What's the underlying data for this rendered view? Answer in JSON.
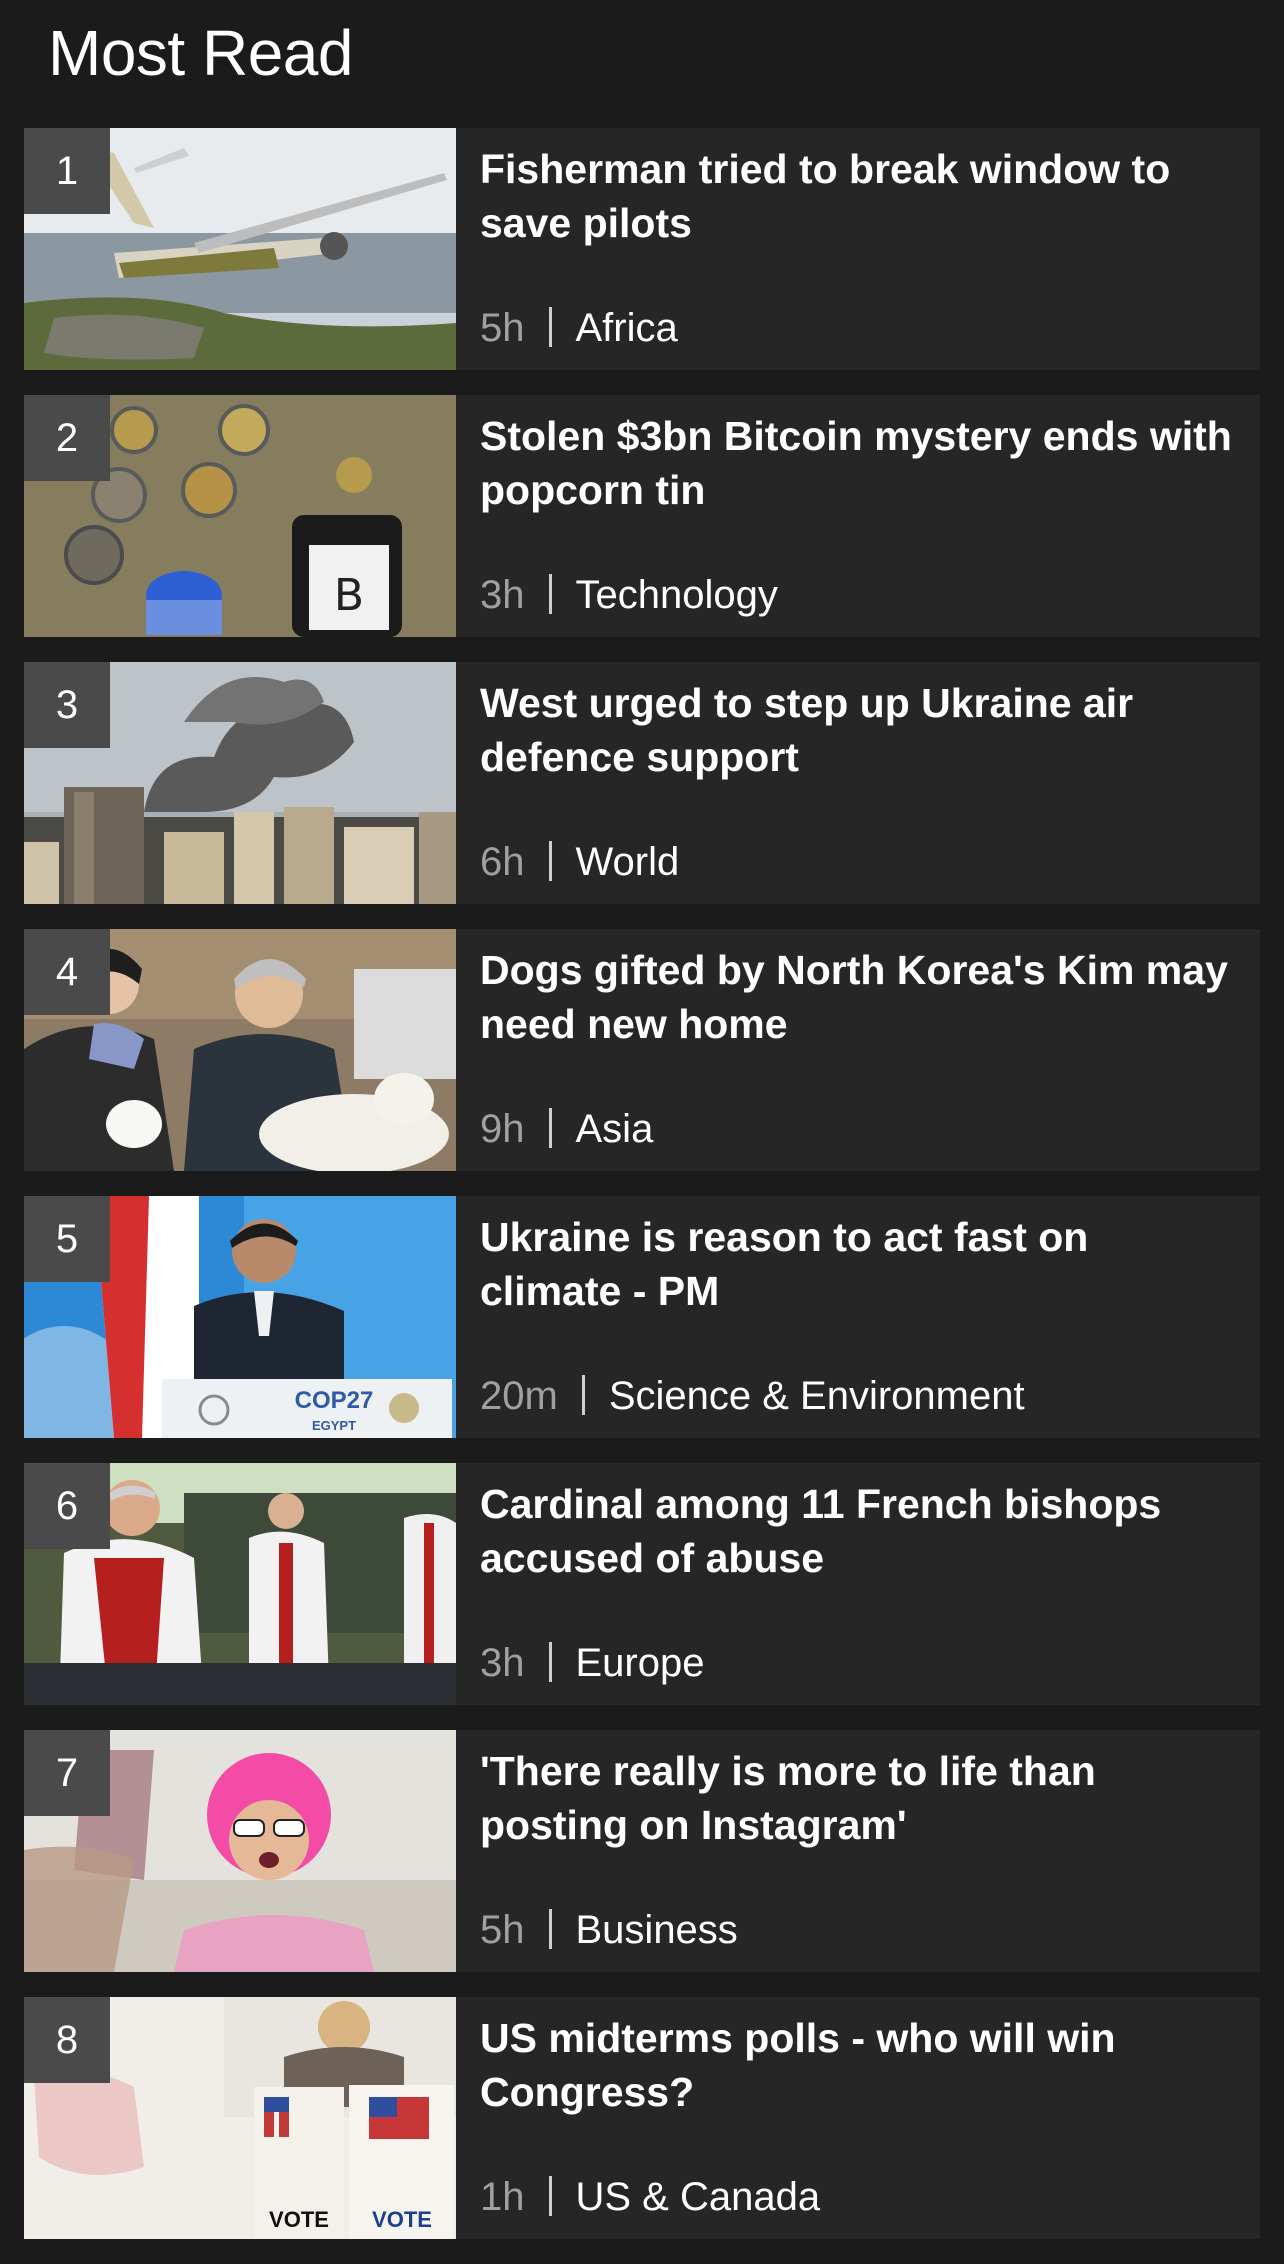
{
  "section": {
    "title": "Most Read"
  },
  "items": [
    {
      "rank": "1",
      "headline": "Fisherman tried to break window to save pilots",
      "time": "5h",
      "category": "Africa",
      "image": "plane-crash-in-lake-photo"
    },
    {
      "rank": "2",
      "headline": "Stolen $3bn Bitcoin mystery ends with popcorn tin",
      "time": "3h",
      "category": "Technology",
      "image": "bitcoin-coins-and-tin-photo"
    },
    {
      "rank": "3",
      "headline": "West urged to step up Ukraine air defence support",
      "time": "6h",
      "category": "World",
      "image": "smoke-over-city-photo"
    },
    {
      "rank": "4",
      "headline": "Dogs gifted by North Korea's Kim may need new home",
      "time": "9h",
      "category": "Asia",
      "image": "couple-with-white-dogs-photo"
    },
    {
      "rank": "5",
      "headline": "Ukraine is reason to act fast on climate - PM",
      "time": "20m",
      "category": "Science & Environment",
      "image": "speaker-at-podium-photo",
      "podium_text": "COP27",
      "podium_subtext": "EGYPT"
    },
    {
      "rank": "6",
      "headline": "Cardinal among 11 French bishops accused of abuse",
      "time": "3h",
      "category": "Europe",
      "image": "clergy-procession-photo"
    },
    {
      "rank": "7",
      "headline": "'There really is more to life than posting on Instagram'",
      "time": "5h",
      "category": "Business",
      "image": "woman-taking-selfie-photo"
    },
    {
      "rank": "8",
      "headline": "US midterms polls - who will win Congress?",
      "time": "1h",
      "category": "US & Canada",
      "image": "voting-booth-photo",
      "booth_text": "VOTE"
    }
  ],
  "colors": {
    "background": "#1b1b1b",
    "card": "#262626",
    "rank_badge": "#4a4a4a",
    "time_text": "#a0a0a0"
  }
}
